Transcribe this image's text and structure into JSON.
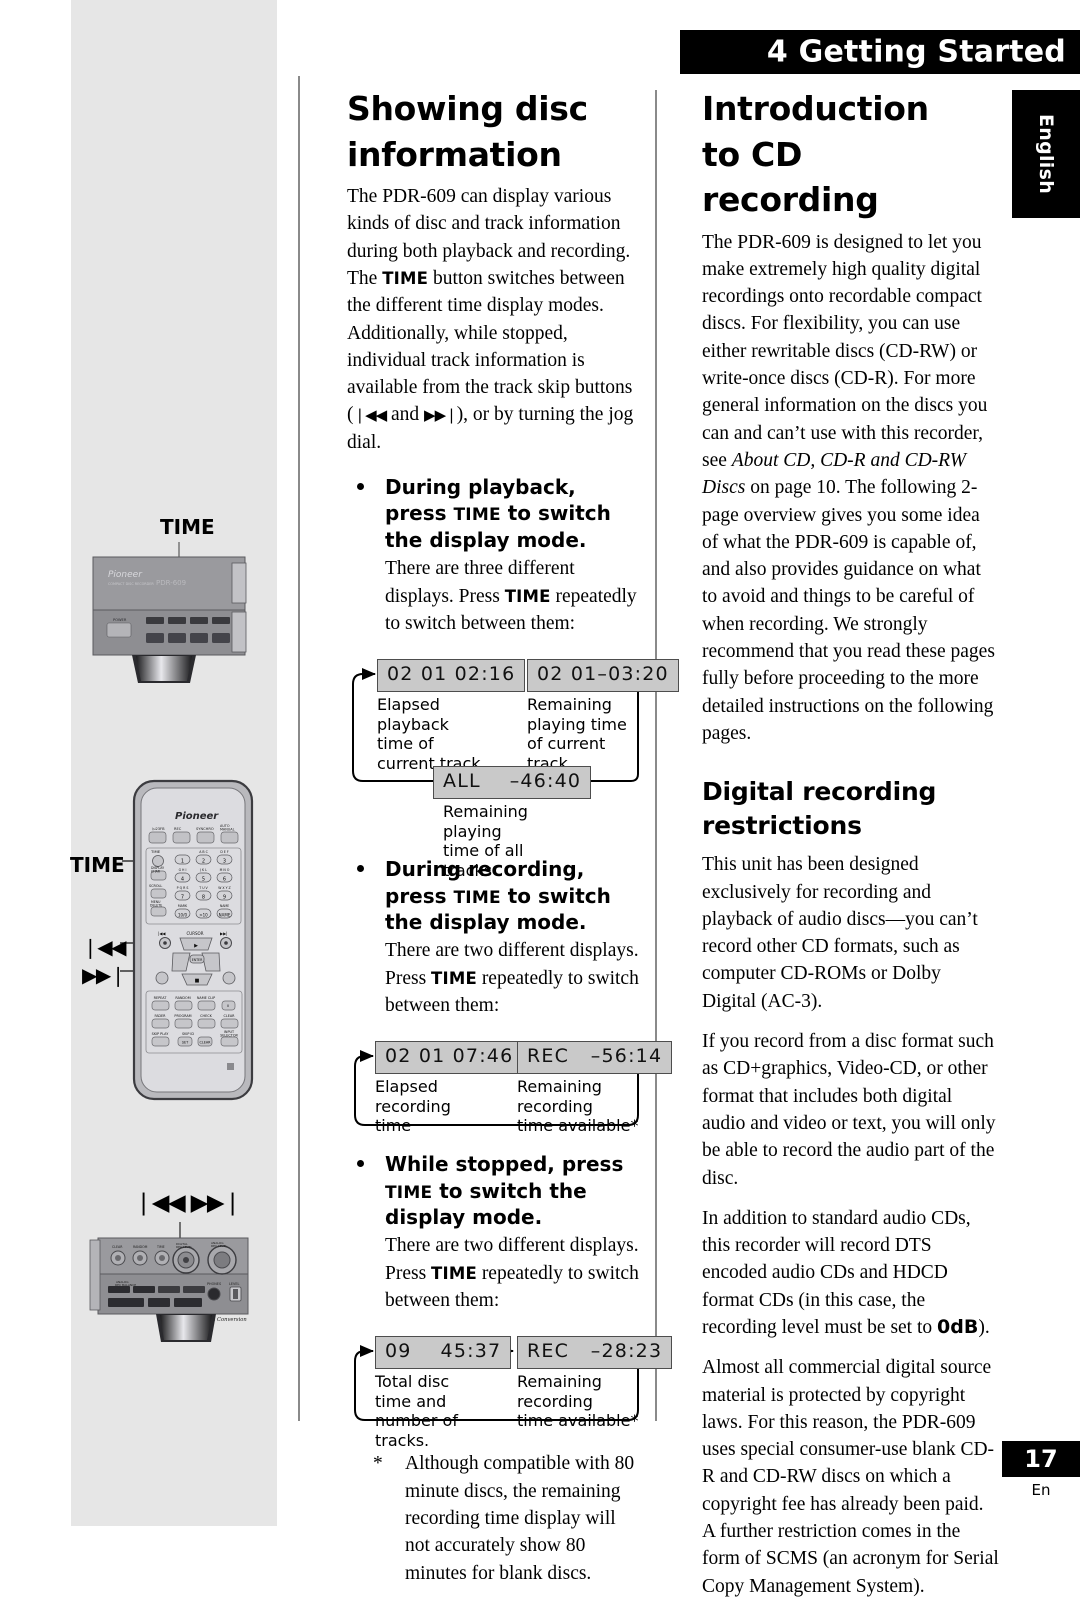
{
  "header": {
    "chapter_number": "4",
    "chapter_title": "Getting Started",
    "full": "4 Getting Started"
  },
  "language_tab": {
    "label": "English"
  },
  "page_footer": {
    "number": "17",
    "lang_code": "En"
  },
  "left_column": {
    "title": "Showing disc information",
    "intro_1": "The PDR-609 can display various kinds of disc and track information during both playback and recording. The ",
    "intro_time": "TIME",
    "intro_2": " button switches between the different time display modes. Additionally, while stopped, individual track information is available from the track skip buttons (",
    "skip_back_glyph": "❘◀◀",
    "intro_3": " and ",
    "skip_fwd_glyph": "▶▶❘",
    "intro_4": "), or by turning the jog dial.",
    "bullets": [
      {
        "heading_a": "During playback, press ",
        "heading_time": "TIME",
        "heading_b": " to switch the display mode.",
        "body_a": "There are three different displays. Press ",
        "body_time": "TIME",
        "body_b": " repeatedly to switch between them:",
        "diagram": {
          "nodes": [
            {
              "display": "02 01 02:16",
              "caption": "Elapsed playback\ntime of current track"
            },
            {
              "display": "02 01–03:20",
              "caption": "Remaining playing time\nof current track"
            },
            {
              "display": "ALL    –46:40",
              "caption": "Remaining playing\ntime of all tracks"
            }
          ]
        }
      },
      {
        "heading_a": "During recording, press ",
        "heading_time": "TIME",
        "heading_b": " to switch the display mode.",
        "body_a": "There are two different displays. Press ",
        "body_time": "TIME",
        "body_b": " repeatedly to switch between them:",
        "diagram": {
          "nodes": [
            {
              "display": "02 01 07:46",
              "caption": "Elapsed recording\ntime"
            },
            {
              "display": "REC   –56:14",
              "caption": "Remaining recording\ntime available*"
            }
          ]
        }
      },
      {
        "heading_a": "While stopped, press ",
        "heading_time": "TIME",
        "heading_b": " to switch the display mode.",
        "body_a": "There are two different displays. Press ",
        "body_time": "TIME",
        "body_b": " repeatedly to switch between them:",
        "diagram": {
          "nodes": [
            {
              "display": "09    45:37",
              "caption": "Total disc time and\nnumber of tracks."
            },
            {
              "display": "REC   –28:23",
              "caption": "Remaining recording\ntime available*"
            }
          ]
        }
      }
    ],
    "footnote_marker": "*",
    "footnote_text": "Although compatible with 80 minute discs, the remaining recording time display will not accurately show 80 minutes for blank discs."
  },
  "right_column": {
    "title": "Introduction to CD recording",
    "intro_a": "The PDR-609 is designed to let you make extremely high quality digital recordings onto recordable compact discs. For flexibility, you can use either rewritable discs (CD-RW) or write-once discs (CD-R). For more general information on the discs you can and can’t use with this recorder, see ",
    "intro_italic": "About CD, CD-R and CD-RW Discs",
    "intro_b": " on page 10. The following 2-page overview gives you some idea of what the PDR-609 is capable of, and also provides guidance on what to avoid and things to be careful of when recording. We strongly recommend that you read these pages fully before proceeding to the more detailed instructions on the following pages.",
    "subtitle": "Digital recording restrictions",
    "para_1": "This unit has been designed exclusively for recording and playback of audio discs—you can’t record other CD formats, such as computer CD-ROMs or Dolby Digital (AC-3).",
    "para_2": "If you record from a disc format such as CD+graphics, Video-CD, or other format that includes both digital audio and video or text, you will only be able to record the audio part of the disc.",
    "para_3_a": "In addition to standard audio CDs, this recorder will record DTS encoded audio CDs and HDCD format CDs (in this case, the recording level must be set to ",
    "para_3_bold": "0dB",
    "para_3_b": ").",
    "para_4": "Almost all commercial digital source material is protected by copyright laws. For this reason, the PDR-609 uses special consumer-use blank CD-R and CD-RW discs on which a copyright fee has already been paid. A further restriction comes in the form of SCMS (an acronym for Serial Copy Management System)."
  },
  "illustrations": {
    "front_panel": {
      "label": "TIME",
      "device_brand": "Pioneer",
      "device_model": "PDR-609",
      "device_subtitle": "COMPACT DISC RECORDER"
    },
    "remote": {
      "label_time": "TIME",
      "label_skip_back": "❘◀◀",
      "label_skip_fwd": "▶▶❘",
      "brand": "Pioneer"
    },
    "front_panel_2": {
      "label_skip": "❘◀◀  ▶▶❘",
      "legato": "Legato Link Conversion"
    }
  },
  "colors": {
    "lcd_background": "#c9c9c9",
    "lcd_border": "#4d4d4d",
    "sidebar_background": "#e6e6e6",
    "header_black": "#000000",
    "rule_grey": "#8a8a8a"
  }
}
